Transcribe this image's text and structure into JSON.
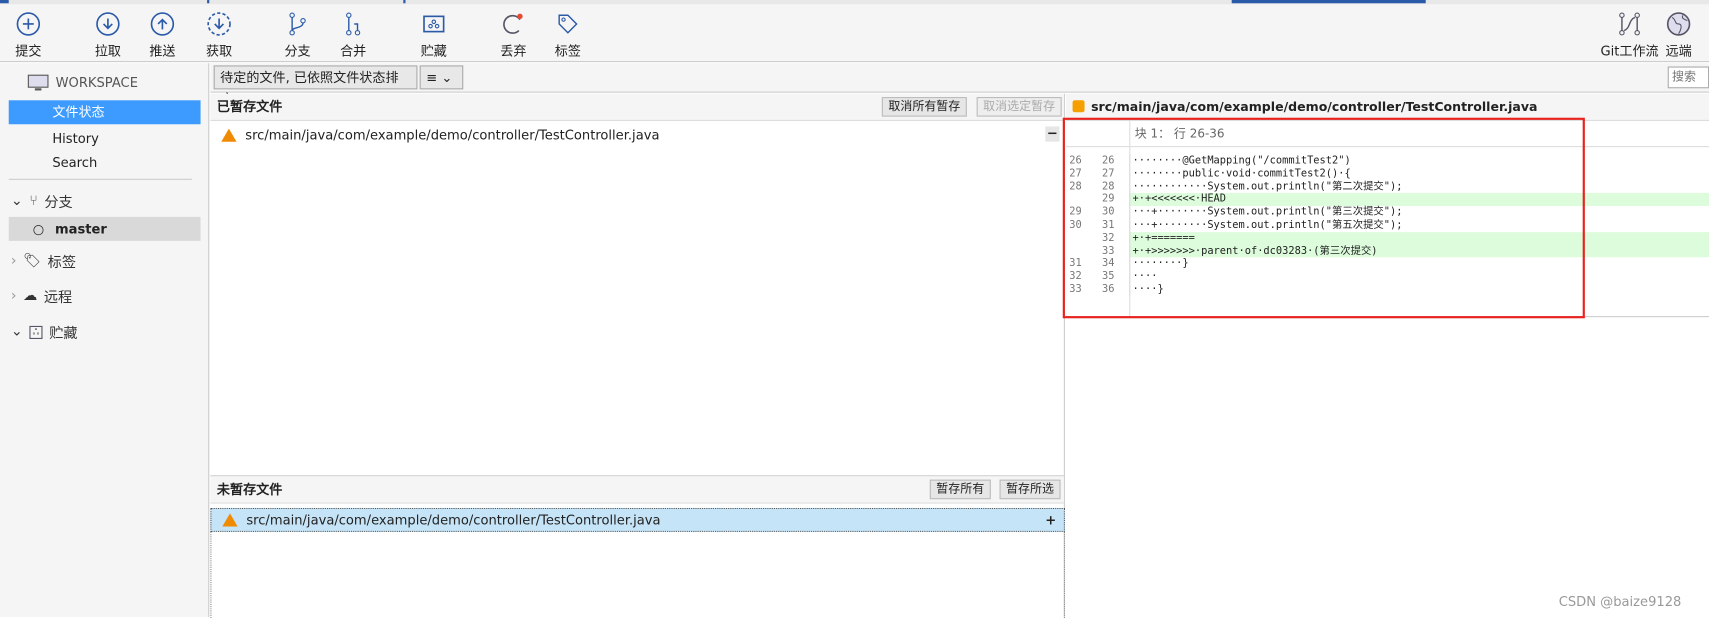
{
  "toolbar": {
    "items": [
      {
        "label": "提交",
        "icon": "commit-icon"
      },
      {
        "label": "拉取",
        "icon": "pull-icon"
      },
      {
        "label": "推送",
        "icon": "push-icon"
      },
      {
        "label": "获取",
        "icon": "fetch-icon"
      },
      {
        "label": "分支",
        "icon": "branch-icon"
      },
      {
        "label": "合并",
        "icon": "merge-icon"
      },
      {
        "label": "贮藏",
        "icon": "stash-icon"
      },
      {
        "label": "丢弃",
        "icon": "discard-icon"
      },
      {
        "label": "标签",
        "icon": "tag-icon"
      }
    ],
    "right": [
      {
        "label": "Git工作流",
        "icon": "git-flow-icon"
      },
      {
        "label": "远端",
        "icon": "globe-icon"
      }
    ]
  },
  "sidebar": {
    "workspace": "WORKSPACE",
    "items": [
      {
        "label": "文件状态",
        "selected": true
      },
      {
        "label": "History"
      },
      {
        "label": "Search"
      }
    ],
    "branches": {
      "label": "分支",
      "items": [
        "master"
      ]
    },
    "tags": "标签",
    "remotes": "远程",
    "stashes": "贮藏"
  },
  "filter": {
    "sort_label": "待定的文件, 已依照文件状态排序",
    "view_label": "≡",
    "search_placeholder": "搜索"
  },
  "staged": {
    "title": "已暂存文件",
    "unstage_all": "取消所有暂存",
    "unstage_selected": "取消选定暂存",
    "files": [
      "src/main/java/com/example/demo/controller/TestController.java"
    ]
  },
  "unstaged": {
    "title": "未暂存文件",
    "stage_all": "暂存所有",
    "stage_selected": "暂存所选",
    "files": [
      "src/main/java/com/example/demo/controller/TestController.java"
    ]
  },
  "diff": {
    "file": "src/main/java/com/example/demo/controller/TestController.java",
    "hunk": "块 1： 行 26-36",
    "lines": [
      {
        "old": "26",
        "new": "26",
        "text": "········@GetMapping(\"/commitTest2\")",
        "add": false
      },
      {
        "old": "27",
        "new": "27",
        "text": "········public·void·commitTest2()·{",
        "add": false
      },
      {
        "old": "28",
        "new": "28",
        "text": "············System.out.println(\"第二次提交\");",
        "add": false
      },
      {
        "old": "",
        "new": "29",
        "text": "+·+<<<<<<<·HEAD",
        "add": true
      },
      {
        "old": "29",
        "new": "30",
        "text": "···+········System.out.println(\"第三次提交\");",
        "add": false
      },
      {
        "old": "30",
        "new": "31",
        "text": "···+········System.out.println(\"第五次提交\");",
        "add": false
      },
      {
        "old": "",
        "new": "32",
        "text": "+·+=======",
        "add": true
      },
      {
        "old": "",
        "new": "33",
        "text": "+·+>>>>>>>·parent·of·dc03283·(第三次提交)",
        "add": true
      },
      {
        "old": "31",
        "new": "34",
        "text": "········}",
        "add": false
      },
      {
        "old": "32",
        "new": "35",
        "text": "····",
        "add": false
      },
      {
        "old": "33",
        "new": "36",
        "text": "····}",
        "add": false
      }
    ]
  },
  "watermark": "CSDN @baize9128",
  "colors": {
    "selected": "#3d9bff",
    "accent": "#2a5aa8",
    "highlight_box": "#e8231f",
    "added_line": "#dcfcdc"
  }
}
